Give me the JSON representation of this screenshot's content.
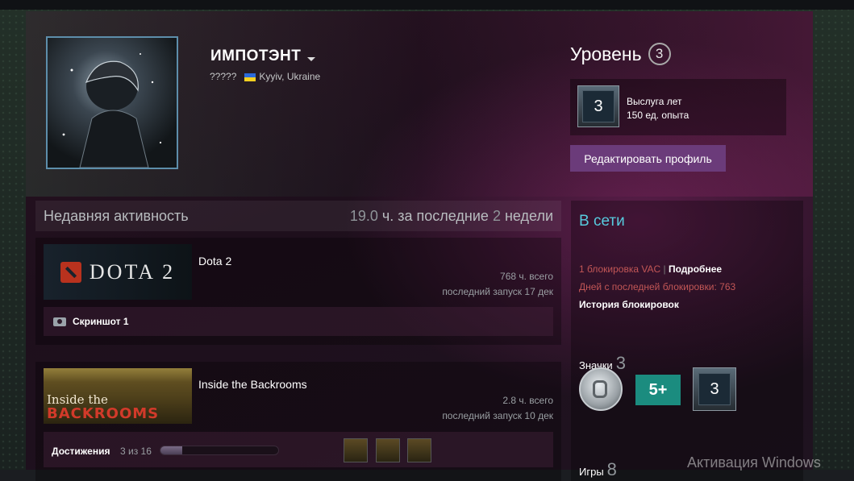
{
  "profile": {
    "persona_name": "ИМПОТЭНТ",
    "real_name": "?????",
    "location": "Kyyiv, Ukraine"
  },
  "level": {
    "label": "Уровень",
    "value": "3"
  },
  "xp": {
    "badge_value": "3",
    "badge_name": "Выслуга лет",
    "points": "150 ед. опыта"
  },
  "edit_button": "Редактировать профиль",
  "activity": {
    "title": "Недавняя активность",
    "hours_value": "19.0",
    "hours_text_1": "ч. за последние",
    "weeks_value": "2",
    "hours_text_2": "недели"
  },
  "games": [
    {
      "name": "Dota 2",
      "capsule_text": "DOTA 2",
      "total": "768 ч. всего",
      "last_played": "последний запуск 17 дек",
      "screenshots": "Скриншот 1"
    },
    {
      "name": "Inside the Backrooms",
      "capsule_line1": "Inside the",
      "capsule_line2": "BACKROOMS",
      "total": "2.8 ч. всего",
      "last_played": "последний запуск 10 дек",
      "achievements_label": "Достижения",
      "achievements_count": "3 из 16",
      "achievements_fraction": 0.1875
    }
  ],
  "sidebar": {
    "status": "В сети",
    "vac_ban": "1 блокировка VAC",
    "vac_more": "Подробнее",
    "days_since_ban": "Дней с последней блокировки: 763",
    "ban_history": "История блокировок",
    "badges_label": "Значки",
    "badges_count": "3",
    "badge_five": "5+",
    "badge_three": "3",
    "games_label": "Игры",
    "games_count": "8"
  },
  "watermark": "Активация Windows",
  "colors": {
    "online": "#57cbde",
    "vac_red": "#c25656",
    "edit_button": "#6b3b7a"
  }
}
